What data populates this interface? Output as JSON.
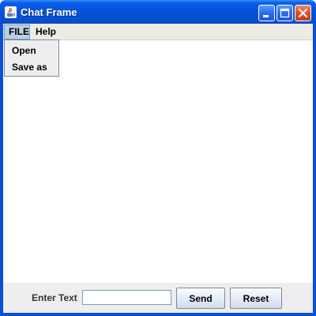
{
  "window": {
    "title": "Chat Frame",
    "title_color": "#ffffff",
    "titlebar_color": "#0653d8",
    "buttons": [
      "minimize-icon",
      "maximize-icon",
      "close-icon"
    ]
  },
  "menubar": {
    "items": [
      {
        "label": "FILE",
        "state": "open"
      },
      {
        "label": "Help"
      }
    ]
  },
  "file_menu": {
    "items": [
      {
        "label": "Open"
      },
      {
        "label": "Save as"
      }
    ]
  },
  "input_panel": {
    "label": "Enter Text",
    "text_value": "",
    "send_label": "Send",
    "reset_label": "Reset"
  }
}
